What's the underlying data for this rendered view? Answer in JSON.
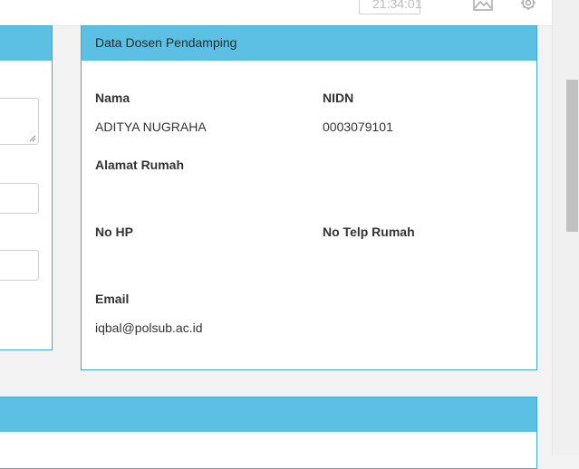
{
  "topbar": {
    "time": "21:34:01",
    "icons": [
      "clock-icon",
      "image-icon",
      "gear-icon"
    ]
  },
  "card": {
    "title": "Data Dosen Pendamping",
    "fields": {
      "nama": {
        "label": "Nama",
        "value": "ADITYA NUGRAHA"
      },
      "nidn": {
        "label": "NIDN",
        "value": "0003079101"
      },
      "alamat": {
        "label": "Alamat Rumah",
        "value": ""
      },
      "nohp": {
        "label": "No HP",
        "value": ""
      },
      "telp": {
        "label": "No Telp Rumah",
        "value": ""
      },
      "email": {
        "label": "Email",
        "value": "iqbal@polsub.ac.id"
      }
    }
  },
  "colors": {
    "header_bg": "#5bc0e4",
    "border": "#3fa9cf"
  }
}
